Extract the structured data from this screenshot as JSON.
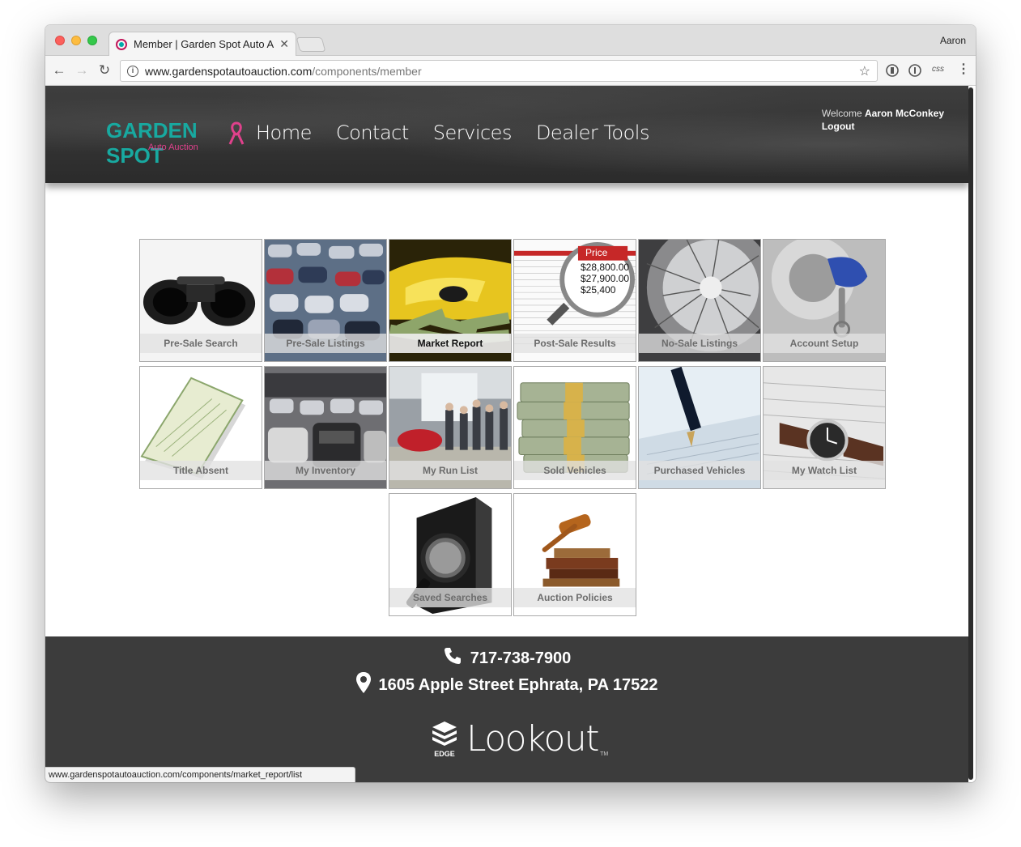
{
  "browser": {
    "tab_title": "Member | Garden Spot Auto Auction",
    "tab_close": "✕",
    "profile_name": "Aaron",
    "url_host": "www.gardenspotautoauction.com",
    "url_path": "/components/member",
    "status_url": "www.gardenspotautoauction.com/components/market_report/list",
    "ext_css_label": "css"
  },
  "header": {
    "logo_main": "GARDEN SPOT",
    "logo_sub": "Auto Auction",
    "nav": [
      "Home",
      "Contact",
      "Services",
      "Dealer Tools"
    ],
    "welcome_prefix": "Welcome",
    "user_name": "Aaron McConkey",
    "logout": "Logout"
  },
  "tiles": [
    {
      "label": "Pre-Sale Search",
      "art": "binoculars"
    },
    {
      "label": "Pre-Sale Listings",
      "art": "car-lot"
    },
    {
      "label": "Market Report",
      "art": "yellow-car-money",
      "active": true
    },
    {
      "label": "Post-Sale Results",
      "art": "price-magnifier"
    },
    {
      "label": "No-Sale Listings",
      "art": "wire-wheel"
    },
    {
      "label": "Account Setup",
      "art": "key-ignition"
    },
    {
      "label": "Title Absent",
      "art": "title-document"
    },
    {
      "label": "My Inventory",
      "art": "suv-lot"
    },
    {
      "label": "My Run List",
      "art": "auction-crowd"
    },
    {
      "label": "Sold Vehicles",
      "art": "cash-stack"
    },
    {
      "label": "Purchased Vehicles",
      "art": "fountain-pen"
    },
    {
      "label": "My Watch List",
      "art": "wristwatch"
    },
    {
      "label": "Saved Searches",
      "art": "folder-magnifier"
    },
    {
      "label": "Auction Policies",
      "art": "gavel-books"
    }
  ],
  "price_overlay": {
    "title": "Price",
    "rows": [
      "$28,800.00",
      "$27,900.00",
      "$25,400"
    ]
  },
  "footer": {
    "phone": "717-738-7900",
    "address": "1605 Apple Street Ephrata, PA 17522",
    "brand_badge": "EDGE",
    "brand_name": "Lookout",
    "brand_tm": "TM"
  },
  "colors": {
    "logo_teal": "#18a9a0",
    "logo_pink": "#e0418c",
    "header_bg": "#2f2f2f",
    "footer_bg": "#3c3c3c"
  }
}
